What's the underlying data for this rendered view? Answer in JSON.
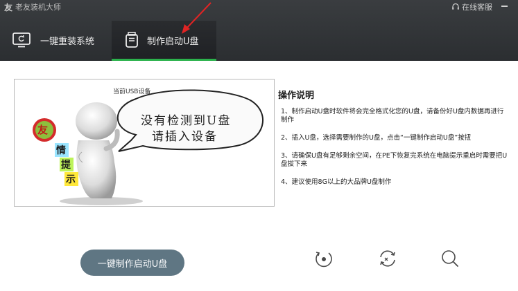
{
  "app": {
    "title": "老友装机大师",
    "service_label": "在线客服"
  },
  "tabs": [
    {
      "label": "一键重装系统",
      "icon": "monitor-icon",
      "active": false
    },
    {
      "label": "制作启动U盘",
      "icon": "usb-drive-icon",
      "active": true
    }
  ],
  "colors": {
    "topbar": "#2f3235",
    "accent": "#2bb24c",
    "button": "#5f7683",
    "annotation_arrow": "#e02424"
  },
  "illustration": {
    "device_label": "当前USB设备",
    "bubble_line1": "没有检测到U盘",
    "bubble_line2": "请插入设备",
    "badge_char": "友",
    "tip_chars": [
      "情",
      "提",
      "示"
    ]
  },
  "instructions": {
    "title": "操作说明",
    "items": [
      "1、制作启动U盘时软件将会完全格式化您的U盘，请备份好U盘内数据再进行制作",
      "2、插入U盘，选择需要制作的U盘，点击“一键制作启动U盘”按扭",
      "3、请确保U盘有足够剩余空间，在PE下恢复完系统在电脑提示重启时需要把U盘拔下来",
      "4、建议使用8G以上的大品牌U盘制作"
    ]
  },
  "actions": {
    "make_button": "一键制作启动U盘",
    "tools": [
      "simulate-boot-icon",
      "refresh-icon",
      "search-icon"
    ]
  }
}
